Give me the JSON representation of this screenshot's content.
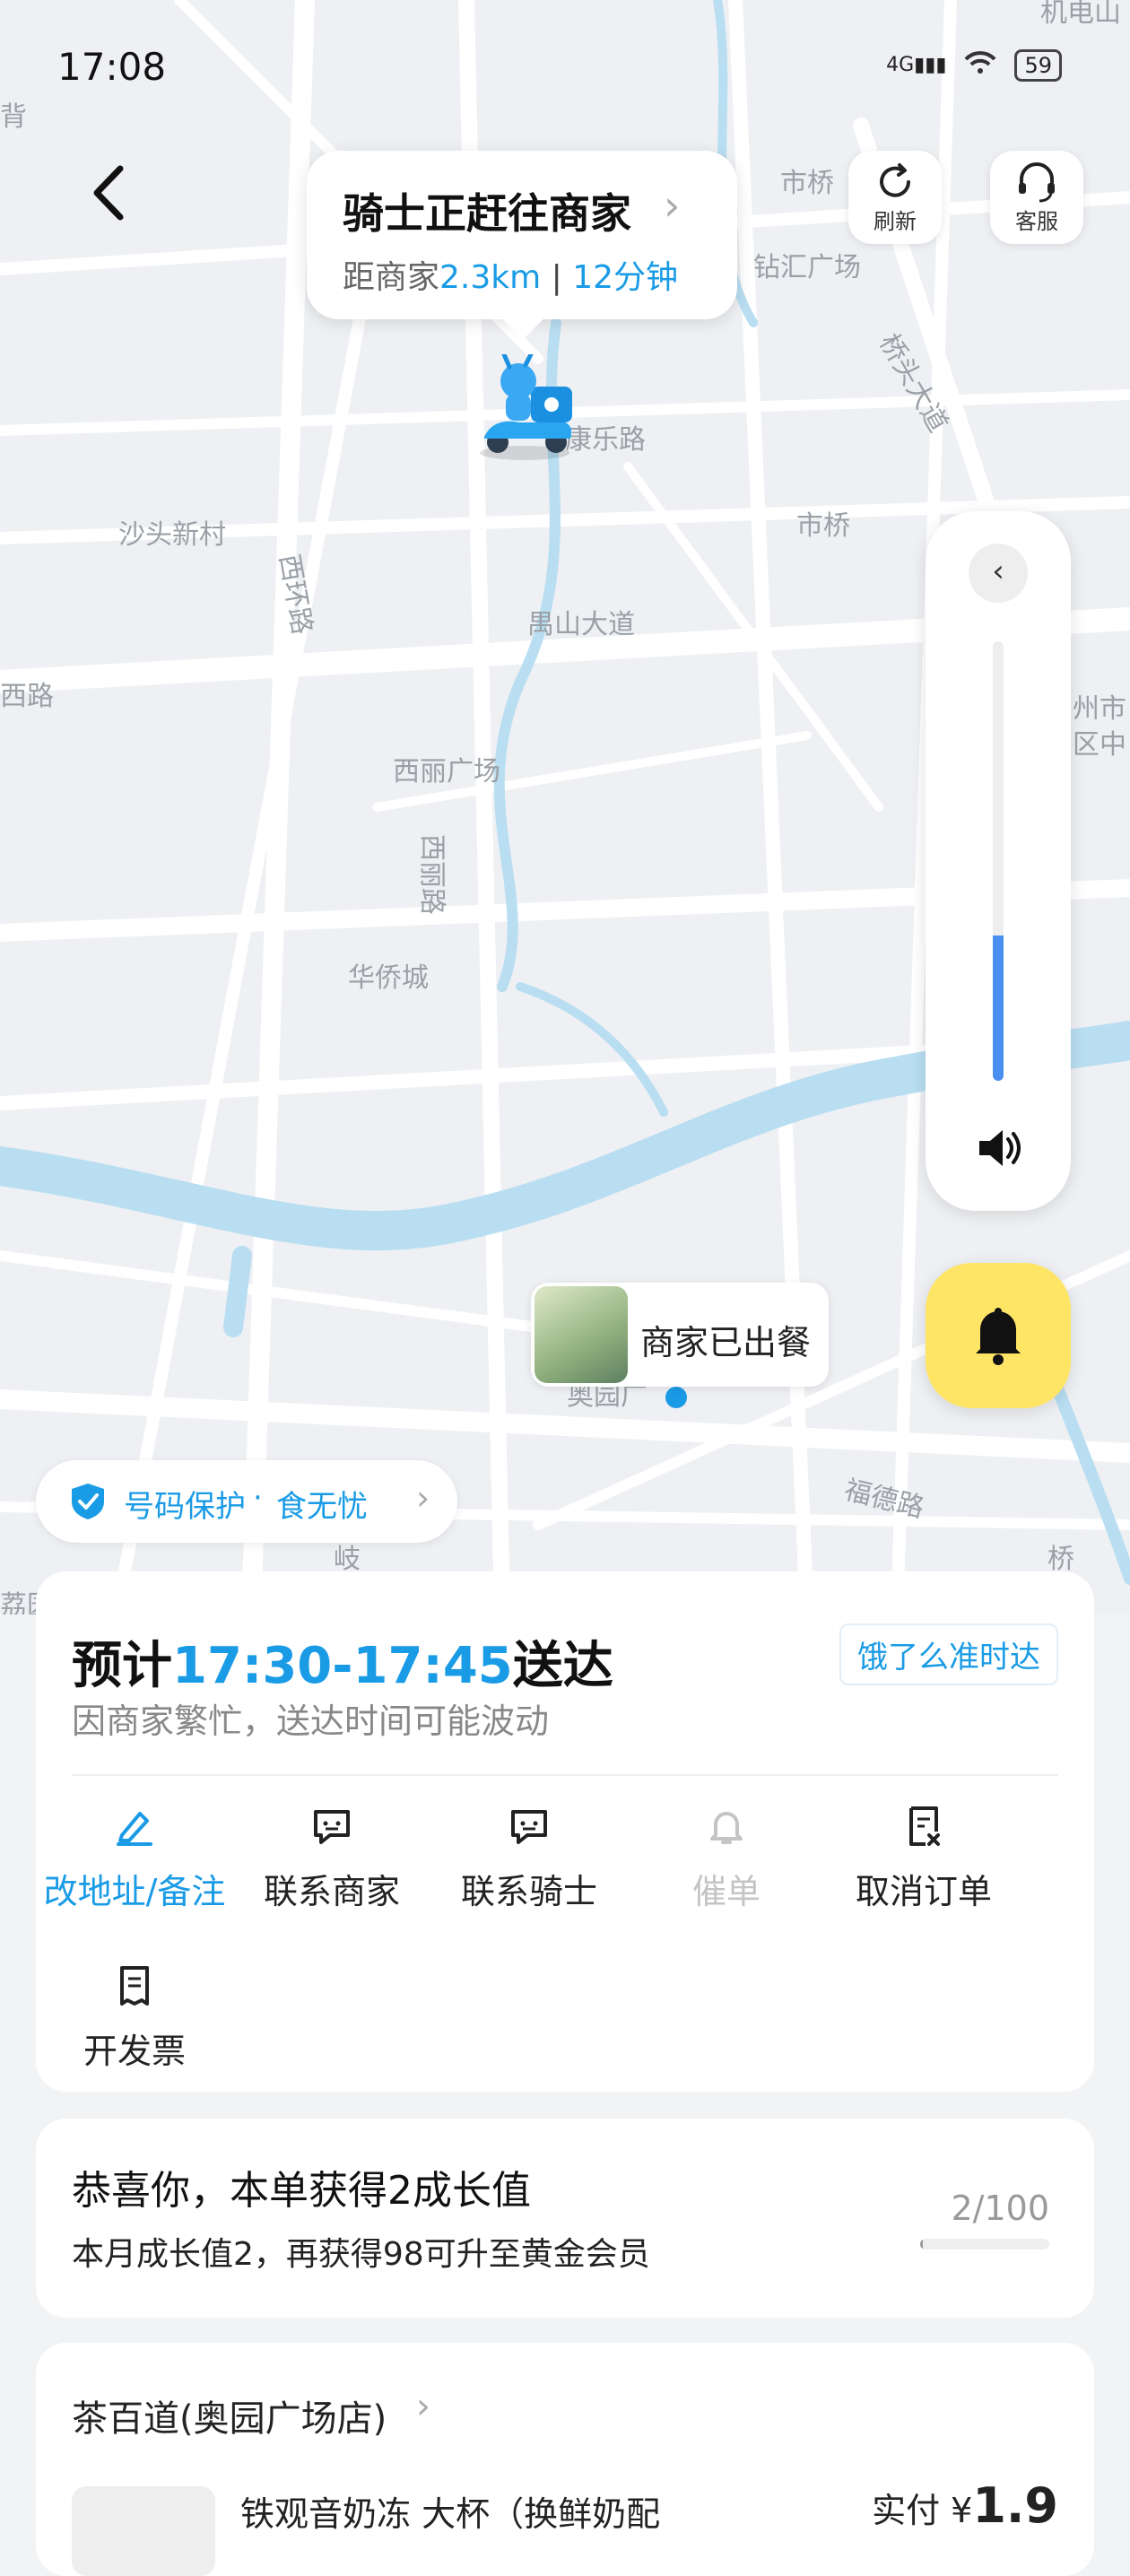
{
  "status_bar": {
    "time": "17:08",
    "network": "4G",
    "battery": "59"
  },
  "map": {
    "labels": [
      "机电山",
      "背",
      "市桥",
      "钻汇广场",
      "桥头大道",
      "康乐路",
      "沙头新村",
      "市桥",
      "西环路",
      "禺山大道",
      "西路",
      "州市",
      "区中",
      "西丽广场",
      "西丽路",
      "华侨城",
      "奥园广",
      "福德路",
      "岐",
      "荔园",
      "桥"
    ]
  },
  "header": {
    "title": "骑士正赶往商家",
    "distance_label": "距商家",
    "distance": "2.3km",
    "separator": "|",
    "eta": "12分钟",
    "refresh": "刷新",
    "service": "客服"
  },
  "volume": {
    "level": 0.33
  },
  "merchant_bubble": {
    "text": "商家已出餐"
  },
  "protect": {
    "a": "号码保护",
    "dot": "·",
    "b": "食无忧"
  },
  "delivery": {
    "prefix": "预计",
    "window": "17:30-17:45",
    "suffix": "送达",
    "note": "因商家繁忙，送达时间可能波动",
    "tag": "饿了么准时达",
    "actions": [
      {
        "label": "改地址/备注",
        "icon": "edit-icon"
      },
      {
        "label": "联系商家",
        "icon": "chat-icon"
      },
      {
        "label": "联系骑士",
        "icon": "chat-icon"
      },
      {
        "label": "催单",
        "icon": "bell-icon"
      },
      {
        "label": "取消订单",
        "icon": "cancel-order-icon"
      },
      {
        "label": "开发票",
        "icon": "invoice-icon"
      }
    ],
    "colors": {
      "accent": "#1a9be6",
      "disabled": "#c4c4c4"
    }
  },
  "growth": {
    "title": "恭喜你，本单获得2成长值",
    "desc": "本月成长值2，再获得98可升至黄金会员",
    "progress_text": "2/100",
    "progress": 0.02
  },
  "shop": {
    "name": "茶百道(奥园广场店)",
    "product": "铁观音奶冻 大杯（换鲜奶配",
    "pay_label": "实付 ¥",
    "pay_value": "1.9"
  }
}
